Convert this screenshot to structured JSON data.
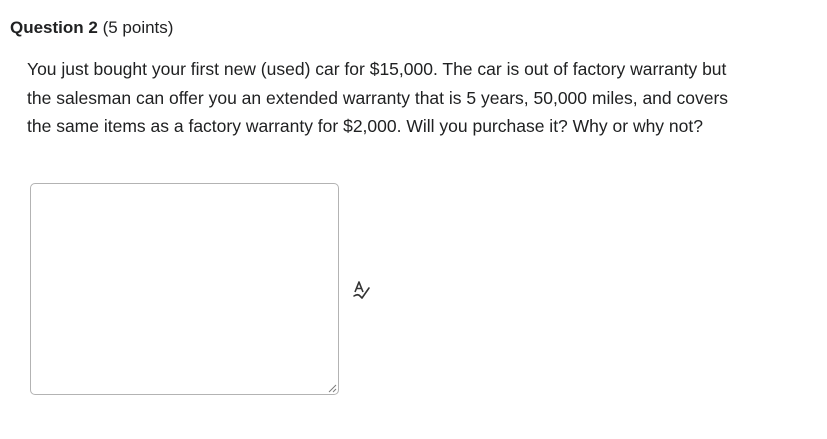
{
  "question": {
    "title": "Question 2",
    "points": " (5 points)",
    "text": "You just bought your first new (used) car for $15,000. The car is out of factory warranty but the salesman can offer you an extended warranty that is 5 years, 50,000 miles, and covers the same items as a factory warranty for $2,000. Will you purchase it? Why or why not?"
  },
  "answer": {
    "value": "",
    "icon": "spell-check-icon"
  }
}
